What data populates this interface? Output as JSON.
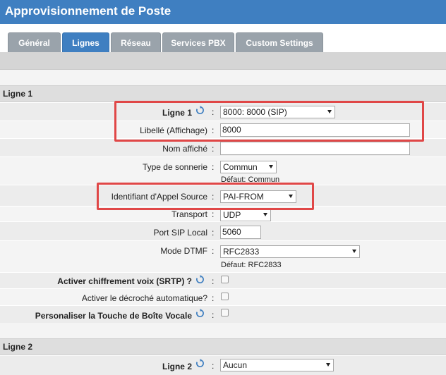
{
  "window": {
    "title": "Approvisionnement de Poste"
  },
  "tabs": [
    "Général",
    "Lignes",
    "Réseau",
    "Services PBX",
    "Custom Settings"
  ],
  "active_tab": "Lignes",
  "sections": {
    "line1": "Ligne 1",
    "line2": "Ligne 2"
  },
  "line1": {
    "account": {
      "label": "Ligne 1",
      "value": "8000: 8000 (SIP)"
    },
    "display_label": {
      "label": "Libellé (Affichage)",
      "value": "8000"
    },
    "display_name": {
      "label": "Nom affiché",
      "value": ""
    },
    "ring_type": {
      "label": "Type de sonnerie",
      "value": "Commun",
      "default": "Défaut: Commun"
    },
    "caller_id_source": {
      "label": "Identifiant d'Appel Source",
      "value": "PAI-FROM"
    },
    "transport": {
      "label": "Transport",
      "value": "UDP"
    },
    "sip_port": {
      "label": "Port SIP Local",
      "value": "5060"
    },
    "dtmf_mode": {
      "label": "Mode DTMF",
      "value": "RFC2833",
      "default": "Défaut: RFC2833"
    },
    "srtp": {
      "label": "Activer chiffrement voix (SRTP) ?",
      "checked": false
    },
    "auto_answer": {
      "label": "Activer le décroché automatique?",
      "checked": false
    },
    "voicemail_key": {
      "label": "Personaliser la Touche de Boîte Vocale",
      "checked": false
    }
  },
  "line2": {
    "account": {
      "label": "Ligne 2",
      "value": "Aucun"
    }
  },
  "colon": ":",
  "colors": {
    "header": "#3f7fc1",
    "highlight": "#e04747",
    "tab_inactive": "#9aa3ab"
  },
  "icons": {
    "refresh": "refresh-icon"
  }
}
